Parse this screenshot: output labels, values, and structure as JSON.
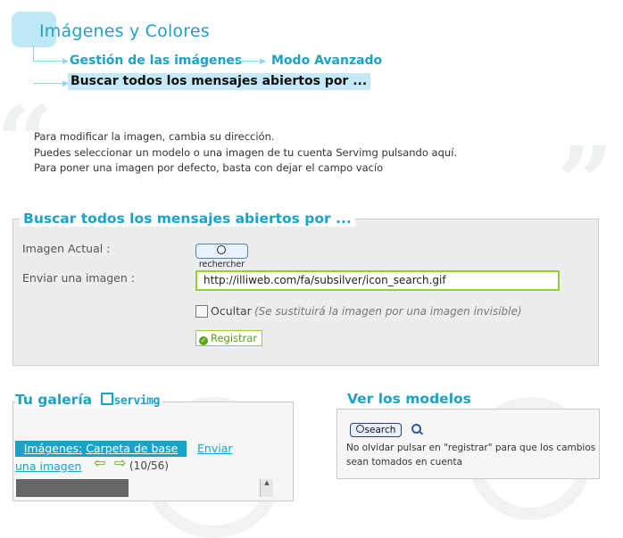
{
  "header": {
    "title": "Imágenes y Colores",
    "breadcrumb": [
      "Gestión de las imágenes",
      "Modo Avanzado"
    ],
    "current": "Buscar todos los mensajes abiertos por ..."
  },
  "intro": {
    "line1": "Para modificar la imagen, cambia su dirección.",
    "line2": "Puedes seleccionar un modelo o una imagen de tu cuenta Servimg pulsando aquí.",
    "line3": "Para poner una imagen por defecto, basta con dejar el campo vacío"
  },
  "form": {
    "legend": "Buscar todos los mensajes abiertos por ...",
    "current_label": "Imagen Actual :",
    "current_image_text": "rechercher",
    "upload_label": "Enviar una imagen :",
    "url_value": "http://illiweb.com/fa/subsilver/icon_search.gif",
    "hide_label": "Ocultar",
    "hide_note": "(Se sustituirá la imagen por una imagen invisible)",
    "hide_checked": false,
    "submit_label": "Registrar"
  },
  "gallery": {
    "legend": "Tu galería",
    "brand": "servimg",
    "tab_label": "Imágenes:",
    "tab_folder": "Carpeta de base",
    "upload_link_1": "Enviar",
    "upload_link_2": "una imagen",
    "counter": "(10/56)"
  },
  "models": {
    "legend": "Ver los modelos",
    "search_text": "search",
    "note": "No olvidar pulsar en \"registrar\" para que los cambios sean tomados en cuenta"
  },
  "colors": {
    "accent": "#1aa3c8",
    "highlight": "#c6e9f7",
    "success": "#9acd32"
  }
}
